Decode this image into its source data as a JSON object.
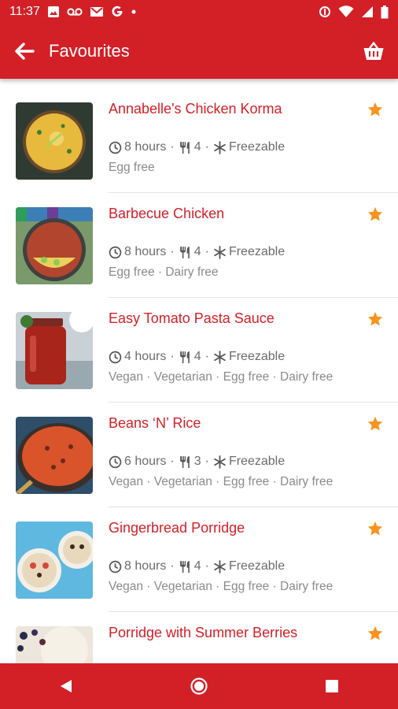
{
  "status_bar": {
    "time": "11:37",
    "left_icons": [
      "image-icon",
      "voicemail-icon",
      "gmail-icon",
      "google-icon",
      "dot-icon"
    ],
    "right_icons": [
      "data-saver-icon",
      "wifi-icon",
      "signal-icon",
      "battery-icon"
    ]
  },
  "app_bar": {
    "title": "Favourites",
    "back_icon": "arrow-left-icon",
    "basket_icon": "basket-icon"
  },
  "recipes": [
    {
      "name": "Annabelle's Chicken Korma",
      "time": "8 hours",
      "serves": "4",
      "freezable": "Freezable",
      "diet": "Egg free"
    },
    {
      "name": "Barbecue Chicken",
      "time": "8 hours",
      "serves": "4",
      "freezable": "Freezable",
      "diet": "Egg free · Dairy free"
    },
    {
      "name": "Easy Tomato Pasta Sauce",
      "time": "4 hours",
      "serves": "4",
      "freezable": "Freezable",
      "diet": "Vegan · Vegetarian · Egg free · Dairy free"
    },
    {
      "name": "Beans ‘N’ Rice",
      "time": "6 hours",
      "serves": "3",
      "freezable": "Freezable",
      "diet": "Vegan · Vegetarian · Egg free · Dairy free"
    },
    {
      "name": "Gingerbread Porridge",
      "time": "8 hours",
      "serves": "4",
      "freezable": "Freezable",
      "diet": "Vegan · Vegetarian · Egg free · Dairy free"
    },
    {
      "name": "Porridge with Summer Berries",
      "time": "",
      "serves": "",
      "freezable": "",
      "diet": ""
    }
  ],
  "meta_separator": "·",
  "nav_bar": {
    "icons": [
      "back-triangle-icon",
      "home-circle-icon",
      "recents-square-icon"
    ]
  },
  "colors": {
    "brand_red": "#d32027",
    "star_orange": "#f7941d",
    "meta_grey": "#6b6b6b"
  }
}
